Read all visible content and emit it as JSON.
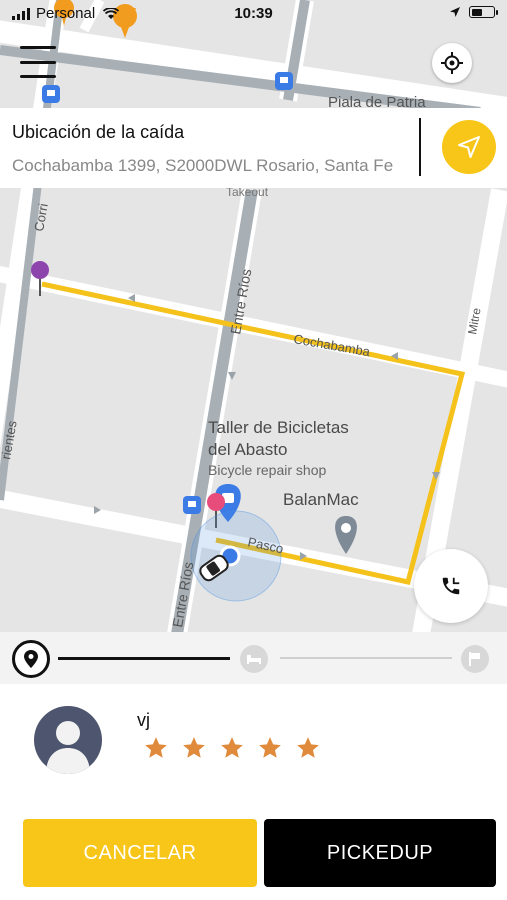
{
  "status_bar": {
    "carrier": "Personal",
    "time": "10:39",
    "battery_level": 0.5
  },
  "map": {
    "labels": {
      "street_top": "Piala de Patria",
      "street_corr": "Corri",
      "street_takeout": "Takeout",
      "street_entre_rios_1": "Entre Ríos",
      "street_entre_rios_2": "Entre Ríos",
      "street_cochabamba": "Cochabamba",
      "street_mitre": "Mitre",
      "street_pasco": "Pasco",
      "street_left": "rientes",
      "poi_shop_name": "Taller de Bicicletas del Abasto",
      "poi_shop_line1": "Taller de Bicicletas",
      "poi_shop_line2": "del Abasto",
      "poi_shop_type": "Bicycle repair shop",
      "poi_balanmac": "BalanMac"
    },
    "colors": {
      "route": "#f4c21b",
      "road": "#ffffff",
      "background": "#e5e5e5",
      "accent_blue": "#4a90e2"
    }
  },
  "drop_off": {
    "title": "Ubicación de la caída",
    "address": "Cochabamba 1399, S2000DWL Rosario, Santa Fe"
  },
  "icons": {
    "menu": "menu-icon",
    "locate": "crosshair-icon",
    "navigate": "navigation-arrow-icon",
    "call": "phone-icon",
    "origin": "location-pin-icon",
    "mid": "bed-icon",
    "end": "finish-flag-icon"
  },
  "progress": {
    "current_step": 1,
    "total_steps": 3
  },
  "driver": {
    "name": "vj",
    "rating": 5,
    "max_rating": 5,
    "star_color": "#e08a3c"
  },
  "actions": {
    "cancel_label": "CANCELAR",
    "pickup_label": "PICKEDUP",
    "cancel_color": "#f7c619",
    "pickup_color": "#000000"
  }
}
